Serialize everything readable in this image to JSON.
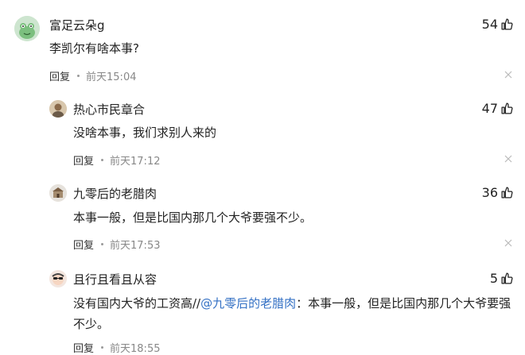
{
  "comments": [
    {
      "username": "富足云朵g",
      "text": "李凯尔有啥本事?",
      "likes": "54",
      "reply_label": "回复",
      "time": "前天15:04"
    },
    {
      "username": "热心市民章合",
      "text": "没啥本事，我们求别人来的",
      "likes": "47",
      "reply_label": "回复",
      "time": "前天17:12"
    },
    {
      "username": "九零后的老腊肉",
      "text": "本事一般，但是比国内那几个大爷要强不少。",
      "likes": "36",
      "reply_label": "回复",
      "time": "前天17:53"
    },
    {
      "username": "且行且看且从容",
      "text_prefix": "没有国内大爷的工资高//",
      "mention": "@九零后的老腊肉",
      "text_suffix": "：本事一般，但是比国内那几个大爷要强不少。",
      "likes": "5",
      "reply_label": "回复",
      "time": "前天18:55"
    }
  ],
  "icons": {
    "like": "thumbs-up-icon",
    "close": "close-icon"
  }
}
